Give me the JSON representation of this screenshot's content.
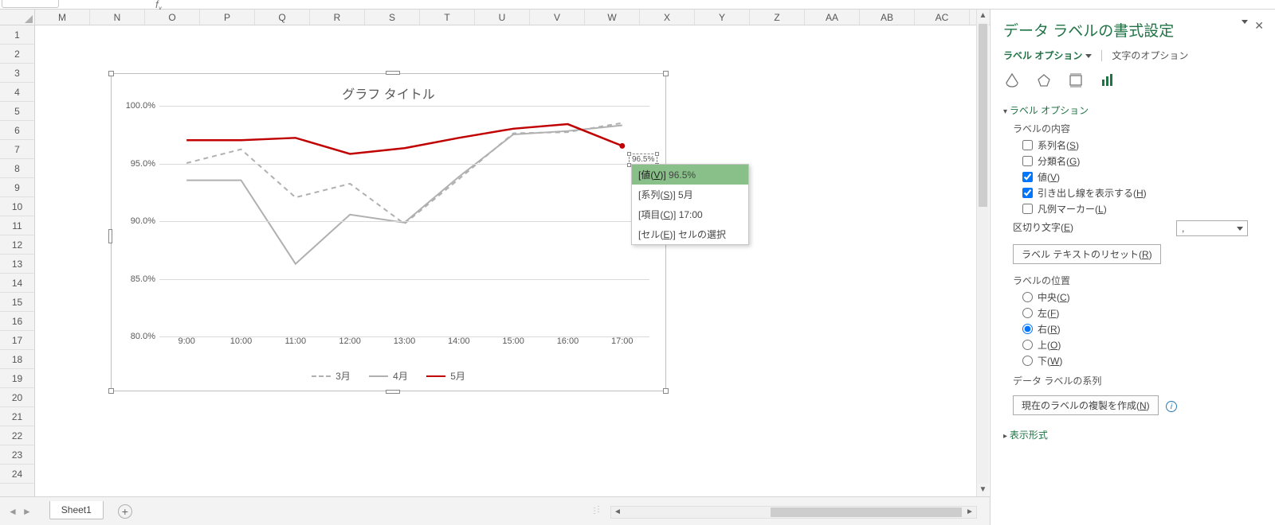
{
  "columns": [
    "M",
    "N",
    "O",
    "P",
    "Q",
    "R",
    "S",
    "T",
    "U",
    "V",
    "W",
    "X",
    "Y",
    "Z",
    "AA",
    "AB",
    "AC"
  ],
  "rows": [
    "1",
    "2",
    "3",
    "4",
    "5",
    "6",
    "7",
    "8",
    "9",
    "10",
    "11",
    "12",
    "13",
    "14",
    "15",
    "16",
    "17",
    "18",
    "19",
    "20",
    "21",
    "22",
    "23",
    "24"
  ],
  "sheet_name": "Sheet1",
  "chart": {
    "title": "グラフ タイトル",
    "legend": [
      "3月",
      "4月",
      "5月"
    ]
  },
  "chart_data": {
    "type": "line",
    "title": "グラフ タイトル",
    "xlabel": "",
    "ylabel": "",
    "x": [
      "9:00",
      "10:00",
      "11:00",
      "12:00",
      "13:00",
      "14:00",
      "15:00",
      "16:00",
      "17:00"
    ],
    "ylim": [
      80.0,
      100.0
    ],
    "yticks": [
      "80.0%",
      "85.0%",
      "90.0%",
      "95.0%",
      "100.0%"
    ],
    "series": [
      {
        "name": "3月",
        "style": "dashed-gray",
        "values": [
          95.0,
          96.2,
          92.0,
          93.2,
          89.7,
          93.6,
          97.6,
          97.7,
          98.5
        ]
      },
      {
        "name": "4月",
        "style": "solid-gray",
        "values": [
          93.5,
          93.5,
          86.2,
          90.5,
          89.8,
          93.8,
          97.5,
          97.8,
          98.3
        ]
      },
      {
        "name": "5月",
        "style": "solid-red",
        "values": [
          97.0,
          97.0,
          97.2,
          95.8,
          96.3,
          97.2,
          98.0,
          98.4,
          96.5
        ]
      }
    ]
  },
  "datalabel_value": "96.5%",
  "context_menu": {
    "value": {
      "label_pre": "[値(",
      "key": "V",
      "label_post": ")]",
      "val": "96.5%"
    },
    "series": {
      "label_pre": "[系列(",
      "key": "S",
      "label_post": ")]",
      "val": "5月"
    },
    "category": {
      "label_pre": "[項目(",
      "key": "C",
      "label_post": ")]",
      "val": "17:00"
    },
    "cell": {
      "label_pre": "[セル(",
      "key": "E",
      "label_post": ")]",
      "val": "セルの選択"
    }
  },
  "pane": {
    "title": "データ ラベルの書式設定",
    "tab_label_options": "ラベル オプション",
    "tab_text_options": "文字のオプション",
    "section_label_options": "ラベル オプション",
    "label_contents": "ラベルの内容",
    "opt_series_name": "系列名(",
    "opt_series_key": "S",
    "opt_close": ")",
    "opt_category_name": "分類名(",
    "opt_category_key": "G",
    "opt_value": "値(",
    "opt_value_key": "V",
    "opt_leader": "引き出し線を表示する(",
    "opt_leader_key": "H",
    "opt_legend_marker": "凡例マーカー(",
    "opt_legend_marker_key": "L",
    "separator_label": "区切り文字(",
    "separator_key": "E",
    "separator_value": ",",
    "reset_btn": "ラベル テキストのリセット(",
    "reset_key": "R",
    "position_label": "ラベルの位置",
    "pos_center": "中央(",
    "pos_center_key": "C",
    "pos_left": "左(",
    "pos_left_key": "F",
    "pos_right": "右(",
    "pos_right_key": "R",
    "pos_above": "上(",
    "pos_above_key": "O",
    "pos_below": "下(",
    "pos_below_key": "W",
    "series_label": "データ ラベルの系列",
    "clone_btn": "現在のラベルの複製を作成(",
    "clone_key": "N",
    "section_number": "表示形式"
  }
}
